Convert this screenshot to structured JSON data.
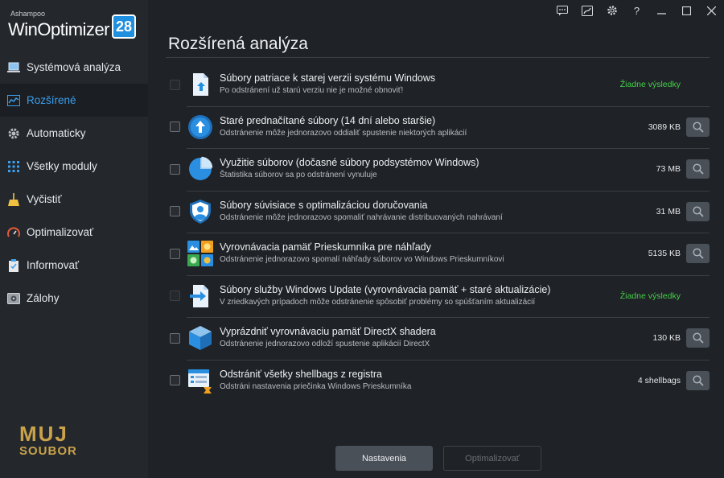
{
  "app": {
    "brand": "Ashampoo",
    "product": "WinOptimizer",
    "version": "28"
  },
  "sidebar": {
    "items": [
      {
        "label": "Systémová analýza",
        "icon": "laptop-icon",
        "active": false
      },
      {
        "label": "Rozšírené",
        "icon": "chart-icon",
        "active": true
      },
      {
        "label": "Automaticky",
        "icon": "gear-icon",
        "active": false
      },
      {
        "label": "Všetky moduly",
        "icon": "grid-icon",
        "active": false
      },
      {
        "label": "Vyčistiť",
        "icon": "broom-icon",
        "active": false
      },
      {
        "label": "Optimalizovať",
        "icon": "gauge-icon",
        "active": false
      },
      {
        "label": "Informovať",
        "icon": "clipboard-icon",
        "active": false
      },
      {
        "label": "Zálohy",
        "icon": "backup-icon",
        "active": false
      }
    ],
    "watermark": {
      "line1": "MUJ",
      "line2": "SOUBOR"
    }
  },
  "titlebar": {
    "icons": [
      "chat-icon",
      "skin-icon",
      "settings-icon",
      "help-icon",
      "minimize-icon",
      "maximize-icon",
      "close-icon"
    ],
    "help": "?"
  },
  "main": {
    "title": "Rozšírená analýza",
    "rows": [
      {
        "title": "Súbory patriace k starej verzii systému Windows",
        "subtitle": "Po odstránení už starú verziu nie je možné obnoviť!",
        "value": "Žiadne výsledky",
        "has_results": false,
        "icon": "windows-file-icon"
      },
      {
        "title": "Staré prednačítané súbory (14 dní alebo staršie)",
        "subtitle": "Odstránenie môže jednorazovo oddialiť spustenie niektorých aplikácií",
        "value": "3089 KB",
        "has_results": true,
        "icon": "prefetch-icon"
      },
      {
        "title": "Využitie súborov (dočasné súbory podsystémov Windows)",
        "subtitle": "Štatistika súborov sa po odstránení vynuluje",
        "value": "73 MB",
        "has_results": true,
        "icon": "pie-chart-icon"
      },
      {
        "title": "Súbory súvisiace s optimalizáciou doručovania",
        "subtitle": "Odstránenie môže jednorazovo spomaliť nahrávanie distribuovaných nahrávaní",
        "value": "31 MB",
        "has_results": true,
        "icon": "shield-user-icon"
      },
      {
        "title": "Vyrovnávacia pamäť Prieskumníka pre náhľady",
        "subtitle": "Odstránenie jednorazovo spomalí náhľady súborov vo Windows Prieskumníkovi",
        "value": "5135 KB",
        "has_results": true,
        "icon": "thumbnails-icon"
      },
      {
        "title": "Súbory služby Windows Update (vyrovnávacia pamäť + staré aktualizácie)",
        "subtitle": "V zriedkavých prípadoch môže odstránenie spôsobiť problémy so spúšťaním aktualizácií",
        "value": "Žiadne výsledky",
        "has_results": false,
        "icon": "windows-update-icon"
      },
      {
        "title": "Vyprázdniť vyrovnávaciu pamäť DirectX shadera",
        "subtitle": "Odstránenie jednorazovo odloží spustenie aplikácií DirectX",
        "value": "130 KB",
        "has_results": true,
        "icon": "cube-icon"
      },
      {
        "title": "Odstrániť všetky shellbags z registra",
        "subtitle": "Odstráni nastavenia priečinka Windows Prieskumníka",
        "value": "4 shellbags",
        "has_results": true,
        "icon": "registry-icon"
      }
    ]
  },
  "footer": {
    "settings_label": "Nastavenia",
    "optimize_label": "Optimalizovať"
  },
  "colors": {
    "accent": "#3aa0f0",
    "no_results": "#44d04a",
    "background": "#1f2226",
    "sidebar": "#24282d"
  }
}
